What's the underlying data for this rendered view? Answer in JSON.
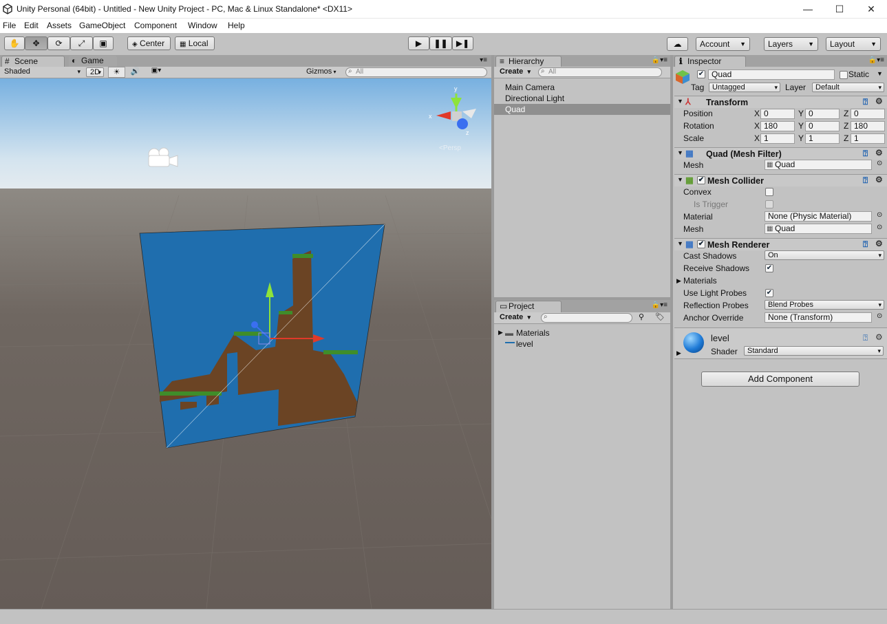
{
  "window": {
    "title": "Unity Personal (64bit) - Untitled - New Unity Project - PC, Mac & Linux Standalone* <DX11>",
    "minimize": "—",
    "maximize": "☐",
    "close": "✕"
  },
  "menu": [
    "File",
    "Edit",
    "Assets",
    "GameObject",
    "Component",
    "Window",
    "Help"
  ],
  "toolbar": {
    "pivot": "Center",
    "space": "Local",
    "account": "Account",
    "layers": "Layers",
    "layout": "Layout"
  },
  "scene": {
    "tab_scene": "Scene",
    "tab_game": "Game",
    "shading": "Shaded",
    "mode_2d": "2D",
    "gizmos": "Gizmos",
    "search_placeholder": "All",
    "axis_x": "x",
    "axis_y": "y",
    "axis_z": "z",
    "persp": "<Persp"
  },
  "hierarchy": {
    "tab": "Hierarchy",
    "create": "Create",
    "search_placeholder": "All",
    "items": [
      "Main Camera",
      "Directional Light",
      "Quad"
    ],
    "selected_index": 2
  },
  "project": {
    "tab": "Project",
    "create": "Create",
    "items": [
      {
        "label": "Materials",
        "kind": "folder"
      },
      {
        "label": "level",
        "kind": "asset"
      }
    ]
  },
  "inspector": {
    "tab": "Inspector",
    "object_name": "Quad",
    "static_label": "Static",
    "tag_label": "Tag",
    "tag_value": "Untagged",
    "layer_label": "Layer",
    "layer_value": "Default",
    "transform": {
      "title": "Transform",
      "rows": [
        {
          "label": "Position",
          "x": "0",
          "y": "0",
          "z": "0"
        },
        {
          "label": "Rotation",
          "x": "180",
          "y": "0",
          "z": "180"
        },
        {
          "label": "Scale",
          "x": "1",
          "y": "1",
          "z": "1"
        }
      ],
      "ax": "X",
      "ay": "Y",
      "az": "Z"
    },
    "mesh_filter": {
      "title": "Quad (Mesh Filter)",
      "mesh_label": "Mesh",
      "mesh_value": "Quad"
    },
    "mesh_collider": {
      "title": "Mesh Collider",
      "convex": "Convex",
      "is_trigger": "Is Trigger",
      "material_label": "Material",
      "material_value": "None (Physic Material)",
      "mesh_label": "Mesh",
      "mesh_value": "Quad"
    },
    "mesh_renderer": {
      "title": "Mesh Renderer",
      "cast_shadows": "Cast Shadows",
      "cast_shadows_value": "On",
      "receive_shadows": "Receive Shadows",
      "materials": "Materials",
      "use_light_probes": "Use Light Probes",
      "reflection_probes": "Reflection Probes",
      "reflection_probes_value": "Blend Probes",
      "anchor_override": "Anchor Override",
      "anchor_override_value": "None (Transform)"
    },
    "material": {
      "name": "level",
      "shader_label": "Shader",
      "shader_value": "Standard"
    },
    "add_component": "Add Component"
  },
  "colors": {
    "panel_bg": "#c2c2c2",
    "selection": "#8f8f8f",
    "quad_blue": "#1f6eae",
    "terrain_brown": "#6b4424",
    "grass": "#3f8d2a"
  }
}
